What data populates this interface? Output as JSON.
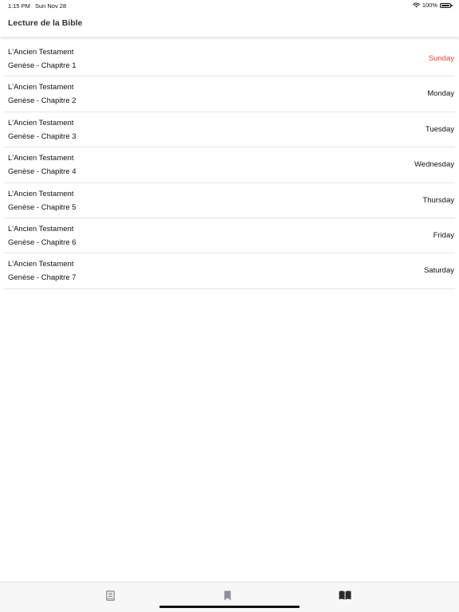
{
  "status_bar": {
    "time": "1:15 PM",
    "date": "Sun Nov 28",
    "battery": "100%"
  },
  "nav": {
    "title": "Lecture de la Bible"
  },
  "colors": {
    "today": "#e8453c",
    "tab_inactive": "#8e8e93",
    "tab_active": "#2c2c2e"
  },
  "readings": [
    {
      "testament": "L'Ancien Testament",
      "chapter": "Genèse - Chapitre 1",
      "day": "Sunday"
    },
    {
      "testament": "L'Ancien Testament",
      "chapter": "Genèse - Chapitre 2",
      "day": "Monday"
    },
    {
      "testament": "L'Ancien Testament",
      "chapter": "Genèse - Chapitre 3",
      "day": "Tuesday"
    },
    {
      "testament": "L'Ancien Testament",
      "chapter": "Genèse - Chapitre 4",
      "day": "Wednesday"
    },
    {
      "testament": "L'Ancien Testament",
      "chapter": "Genèse - Chapitre 5",
      "day": "Thursday"
    },
    {
      "testament": "L'Ancien Testament",
      "chapter": "Genèse - Chapitre 6",
      "day": "Friday"
    },
    {
      "testament": "L'Ancien Testament",
      "chapter": "Genèse - Chapitre 7",
      "day": "Saturday"
    }
  ],
  "tabs": [
    {
      "icon": "book-icon",
      "active": false
    },
    {
      "icon": "bookmark-icon",
      "active": false
    },
    {
      "icon": "open-book-icon",
      "active": true
    }
  ]
}
